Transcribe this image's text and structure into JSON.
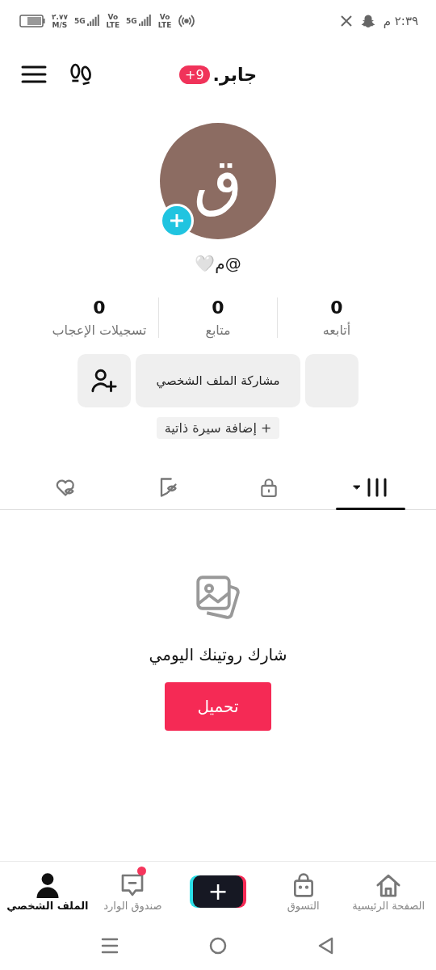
{
  "status_bar": {
    "time": "٢:٣٩ م",
    "speed": "٢.٧٧",
    "speed_unit": "M/S",
    "networks": [
      {
        "label": "Vo",
        "sub": "LTE",
        "kind": "volte"
      },
      {
        "label": "5G",
        "kind": "signal"
      },
      {
        "label": "Vo",
        "sub": "LTE",
        "kind": "volte"
      },
      {
        "label": "5G",
        "kind": "signal"
      }
    ]
  },
  "header": {
    "title": "جابر.",
    "badge": "9+"
  },
  "profile": {
    "avatar_letter": "ق",
    "handle": "@م🤍"
  },
  "stats": [
    {
      "value": "0",
      "label": "أتابعه"
    },
    {
      "value": "0",
      "label": "متابع"
    },
    {
      "value": "0",
      "label": "تسجيلات الإعجاب"
    }
  ],
  "actions": [
    {
      "kind": "blank"
    },
    {
      "kind": "text",
      "label": "مشاركة الملف الشخصي"
    },
    {
      "kind": "add-friend"
    }
  ],
  "bio_button": "+ إضافة سيرة ذاتية",
  "tabs": [
    {
      "kind": "grid",
      "selected": true
    },
    {
      "kind": "lock",
      "selected": false
    },
    {
      "kind": "saved",
      "selected": false
    },
    {
      "kind": "liked",
      "selected": false
    }
  ],
  "empty_state": {
    "message": "شارك روتينك اليومي",
    "button": "تحميل"
  },
  "bottom_nav": [
    {
      "kind": "home",
      "label": "الصفحة الرئيسية",
      "selected": false
    },
    {
      "kind": "shop",
      "label": "التسوق",
      "selected": false
    },
    {
      "kind": "create",
      "label": "+",
      "selected": false
    },
    {
      "kind": "inbox",
      "label": "صندوق الوارد",
      "selected": false,
      "dot": true
    },
    {
      "kind": "profile",
      "label": "الملف الشخصي",
      "selected": true
    }
  ]
}
